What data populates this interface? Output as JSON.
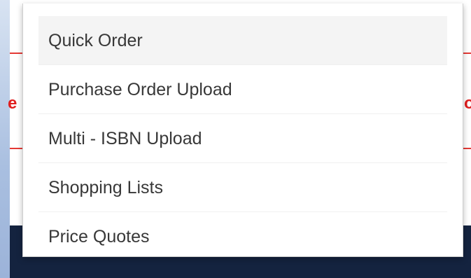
{
  "menu": {
    "items": [
      {
        "label": "Quick Order",
        "highlighted": true
      },
      {
        "label": "Purchase Order Upload",
        "highlighted": false
      },
      {
        "label": "Multi - ISBN Upload",
        "highlighted": false
      },
      {
        "label": "Shopping Lists",
        "highlighted": false
      },
      {
        "label": "Price Quotes",
        "highlighted": false
      }
    ]
  },
  "background": {
    "left_text_fragment": "e",
    "right_text_fragment": "o",
    "accent_color": "#e53935",
    "footer_color": "#14233f"
  }
}
